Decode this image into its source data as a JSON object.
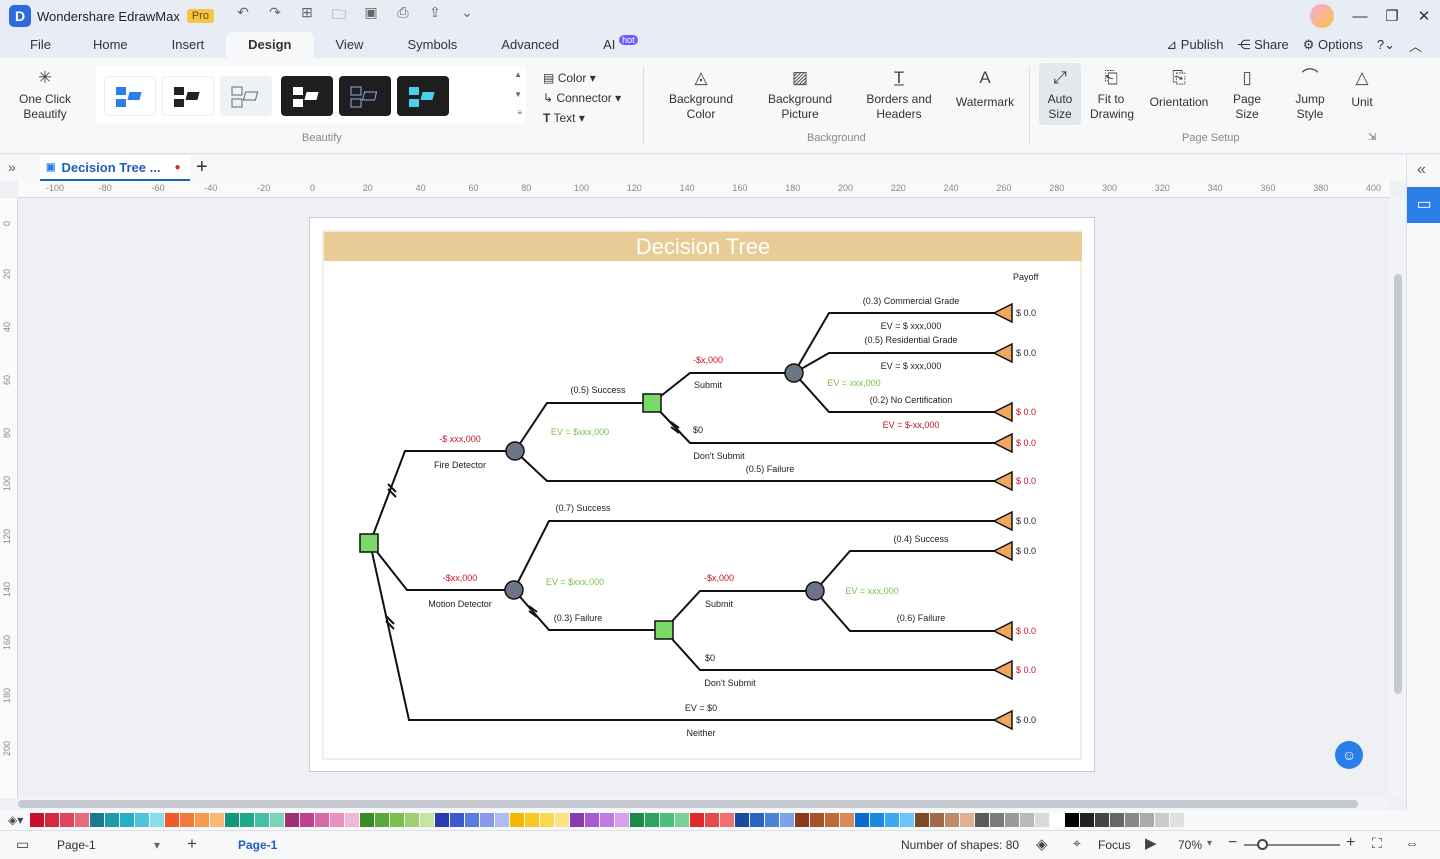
{
  "app": {
    "name": "Wondershare EdrawMax",
    "badge": "Pro"
  },
  "menu": {
    "items": [
      "File",
      "Home",
      "Insert",
      "Design",
      "View",
      "Symbols",
      "Advanced",
      "AI"
    ],
    "hot": "hot",
    "right": {
      "publish": "Publish",
      "share": "Share",
      "options": "Options"
    }
  },
  "ribbon": {
    "one_click": "One Click Beautify",
    "color": "Color",
    "connector": "Connector",
    "text": "Text",
    "beautify_group": "Beautify",
    "background_color": "Background Color",
    "background_picture": "Background Picture",
    "borders_headers": "Borders and Headers",
    "watermark": "Watermark",
    "background_group": "Background",
    "auto_size": "Auto Size",
    "fit_to_drawing": "Fit to Drawing",
    "orientation": "Orientation",
    "page_size": "Page Size",
    "jump_style": "Jump Style",
    "unit": "Unit",
    "page_setup_group": "Page Setup"
  },
  "tab": {
    "title": "Decision Tree ..."
  },
  "ruler": {
    "h_ticks": [
      "-100",
      "-80",
      "-60",
      "-40",
      "-20",
      "0",
      "20",
      "40",
      "60",
      "80",
      "100",
      "120",
      "140",
      "160",
      "180",
      "200",
      "220",
      "240",
      "260",
      "280",
      "300",
      "320",
      "340",
      "360",
      "380",
      "400"
    ],
    "v_ticks": [
      "0",
      "20",
      "40",
      "60",
      "80",
      "100",
      "120",
      "140",
      "160",
      "180",
      "200"
    ]
  },
  "diagram": {
    "title": "Decision Tree",
    "payoff_header": "Payoff",
    "labels": {
      "commercial": "(0.3) Commercial Grade",
      "ev1": "EV = $ xxx,000",
      "residential": "(0.5) Residential Grade",
      "ev2": "EV = $ xxx,000",
      "no_cert": "(0.2) No Certification",
      "ev_neg": "EV = $-xx,000",
      "cost_submit": "-$x,000",
      "submit": "Submit",
      "ev_green1": "EV = xxx,000",
      "zero": "$0",
      "dont_submit": "Don't Submit",
      "success1": "(0.5) Success",
      "ev_green2": "EV = $xxx,000",
      "failure1": "(0.5) Failure",
      "cost_fire": "-$ xxx,000",
      "fire": "Fire Detector",
      "success2": "(0.7) Success",
      "success3": "(0.4) Success",
      "cost_motion": "-$xx,000",
      "ev_green3": "EV = $xxx,000",
      "cost_submit2": "-$x,000",
      "ev_green4": "EV = xxx,000",
      "motion": "Motion Detector",
      "failure2": "(0.3) Failure",
      "submit2": "Submit",
      "failure3": "(0.6) Failure",
      "zero2": "$0",
      "dont_submit2": "Don't Submit",
      "ev_zero": "EV = $0",
      "neither": "Neither"
    },
    "payoffs": [
      "$ 0.0",
      "$ 0.0",
      "$ 0.0",
      "$ 0.0",
      "$ 0.0",
      "$ 0.0",
      "$ 0.0",
      "$ 0.0",
      "$ 0.0",
      "$ 0.0"
    ]
  },
  "palette_colors": [
    "#c8102e",
    "#d42a3c",
    "#e0455a",
    "#e86a7a",
    "#1a7a8a",
    "#1e9aa8",
    "#26b0c8",
    "#4cc4dc",
    "#8adcec",
    "#f05a28",
    "#f47a3c",
    "#f79a50",
    "#fbb870",
    "#14967a",
    "#1eaa8a",
    "#46c0a4",
    "#7ad4bc",
    "#a03070",
    "#c04090",
    "#d868a8",
    "#e890c0",
    "#f0b8d8",
    "#3a8a2a",
    "#5aa83a",
    "#7ac04a",
    "#a0d070",
    "#c8e4a0",
    "#2a3ab0",
    "#3a5ad0",
    "#5a7ae0",
    "#8a9ae8",
    "#b0bcf0",
    "#f5b800",
    "#f8c820",
    "#fad850",
    "#fce480",
    "#8a3ab0",
    "#a85ad0",
    "#c07ae0",
    "#d8a0ec",
    "#1a8a4a",
    "#2aa45e",
    "#4abe7a",
    "#7ad09a",
    "#e02a2a",
    "#e84a4a",
    "#f07070",
    "#1a4aa0",
    "#2a64c0",
    "#4a84d8",
    "#7aa4e8",
    "#8a3a1a",
    "#a8502a",
    "#c06a3a",
    "#d88a5a",
    "#0a6ad0",
    "#1a8ae0",
    "#3aaaf0",
    "#6ac4f8",
    "#7a4a2a",
    "#a06a4a",
    "#c08a6a",
    "#e0b090",
    "#5a5a5a",
    "#7a7a7a",
    "#9a9a9a",
    "#bababa",
    "#dadada",
    "#ffffff",
    "#000000",
    "#222222",
    "#444444",
    "#666666",
    "#888888",
    "#aaaaaa",
    "#cccccc",
    "#e0e0e0"
  ],
  "status": {
    "page_select": "Page-1",
    "page_tab": "Page-1",
    "shapes": "Number of shapes: 80",
    "focus": "Focus",
    "zoom": "70%"
  }
}
